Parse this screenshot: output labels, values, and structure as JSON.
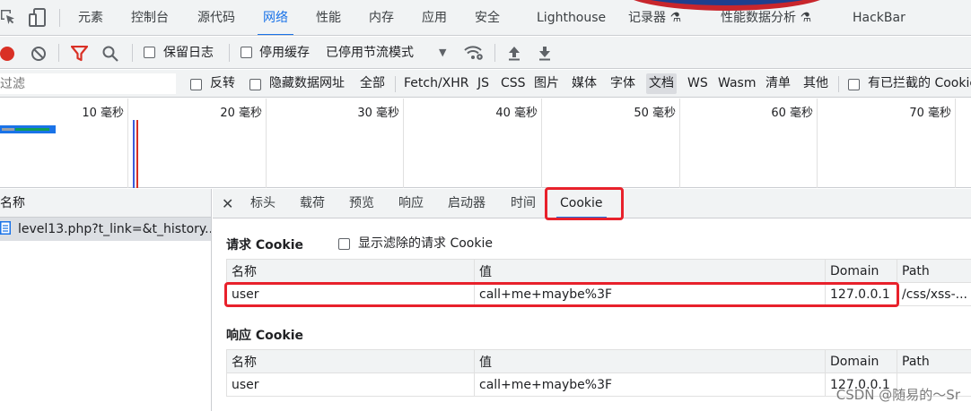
{
  "panel_tabs": [
    {
      "label": "元素",
      "active": false
    },
    {
      "label": "控制台",
      "active": false
    },
    {
      "label": "源代码",
      "active": false
    },
    {
      "label": "网络",
      "active": true
    },
    {
      "label": "性能",
      "active": false
    },
    {
      "label": "内存",
      "active": false
    },
    {
      "label": "应用",
      "active": false
    },
    {
      "label": "安全",
      "active": false
    },
    {
      "label": "Lighthouse",
      "active": false
    },
    {
      "label": "记录器 ⚗",
      "active": false
    },
    {
      "label": "性能数据分析 ⚗",
      "active": false
    },
    {
      "label": "HackBar",
      "active": false
    }
  ],
  "toolbar": {
    "preserve_log": "保留日志",
    "disable_cache": "停用缓存",
    "throttling": "已停用节流模式"
  },
  "filter": {
    "placeholder": "过滤",
    "invert": "反转",
    "hide_data_urls": "隐藏数据网址",
    "types": [
      "全部",
      "Fetch/XHR",
      "JS",
      "CSS",
      "图片",
      "媒体",
      "字体",
      "文档",
      "WS",
      "Wasm",
      "清单",
      "其他"
    ],
    "active_type": "文档",
    "blocked_cookies": "有已拦截的 Cookie"
  },
  "overview": {
    "ticks": [
      "10 毫秒",
      "20 毫秒",
      "30 毫秒",
      "40 毫秒",
      "50 毫秒",
      "60 毫秒",
      "70 毫秒"
    ]
  },
  "request_list": {
    "header": "名称",
    "rows": [
      "level13.php?t_link=&t_history..."
    ]
  },
  "detail_tabs": [
    {
      "label": "标头",
      "active": false
    },
    {
      "label": "载荷",
      "active": false
    },
    {
      "label": "预览",
      "active": false
    },
    {
      "label": "响应",
      "active": false
    },
    {
      "label": "启动器",
      "active": false
    },
    {
      "label": "时间",
      "active": false
    },
    {
      "label": "Cookie",
      "active": true
    }
  ],
  "request_cookies": {
    "title": "请求 Cookie",
    "show_filtered": "显示滤除的请求 Cookie",
    "columns": [
      "名称",
      "值",
      "Domain",
      "Path"
    ],
    "rows": [
      [
        "user",
        "call+me+maybe%3F",
        "127.0.0.1",
        "/css/xss-..."
      ]
    ]
  },
  "response_cookies": {
    "title": "响应 Cookie",
    "columns": [
      "名称",
      "值",
      "Domain",
      "Path"
    ],
    "rows": [
      [
        "user",
        "call+me+maybe%3F",
        "127.0.0.1",
        ""
      ]
    ]
  },
  "watermark": "CSDN @随易的～Sr",
  "colors": {
    "accent": "#1a73e8",
    "highlight_box": "#e8212b",
    "record": "#d93025"
  }
}
